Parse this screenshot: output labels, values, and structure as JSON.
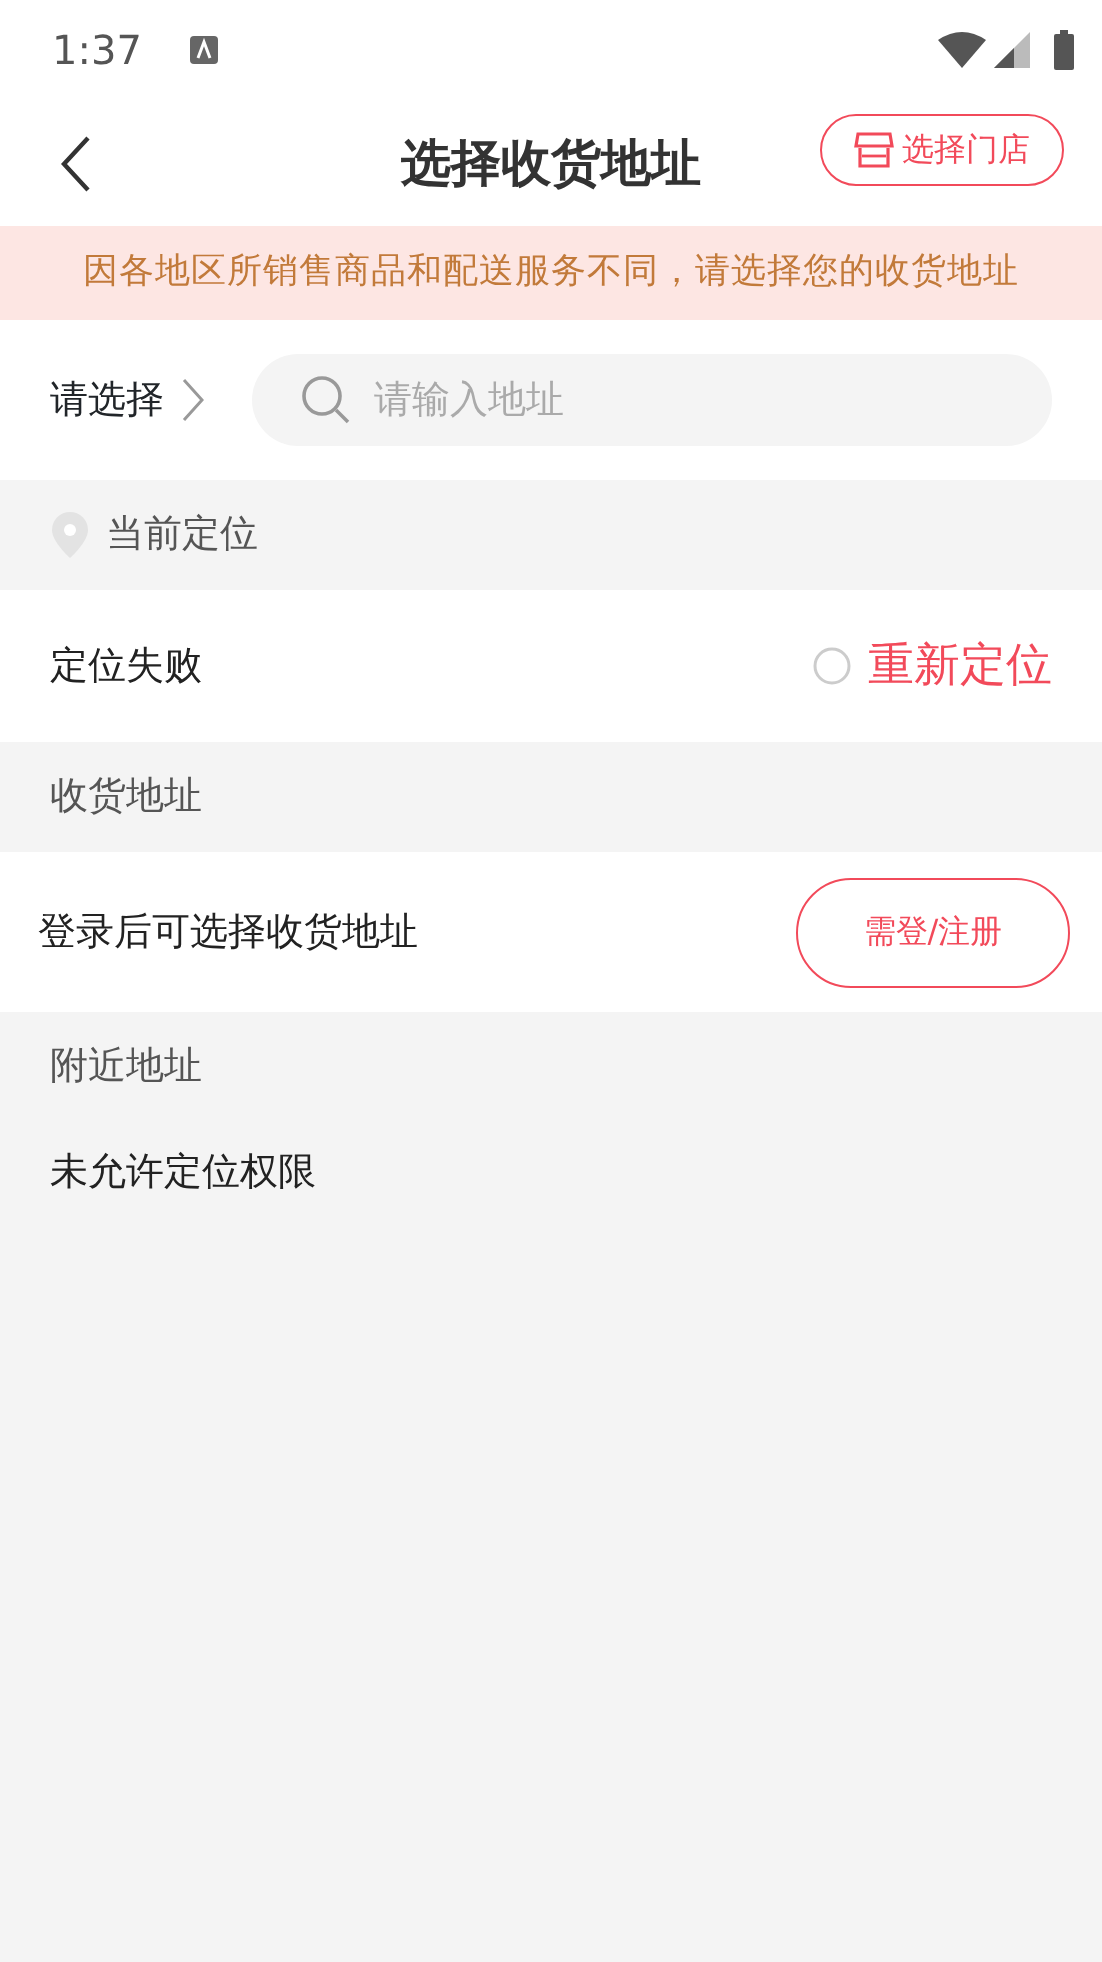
{
  "status_bar": {
    "time": "1:37"
  },
  "header": {
    "title": "选择收货地址",
    "store_button": "选择门店"
  },
  "notice": "因各地区所销售商品和配送服务不同，请选择您的收货地址",
  "search": {
    "region": "请选择",
    "placeholder": "请输入地址"
  },
  "current_location": {
    "heading": "当前定位",
    "status": "定位失败",
    "relocate": "重新定位"
  },
  "shipping": {
    "heading": "收货地址",
    "message": "登录后可选择收货地址",
    "login_button": "需登/注册"
  },
  "nearby": {
    "heading": "附近地址",
    "message": "未允许定位权限"
  }
}
